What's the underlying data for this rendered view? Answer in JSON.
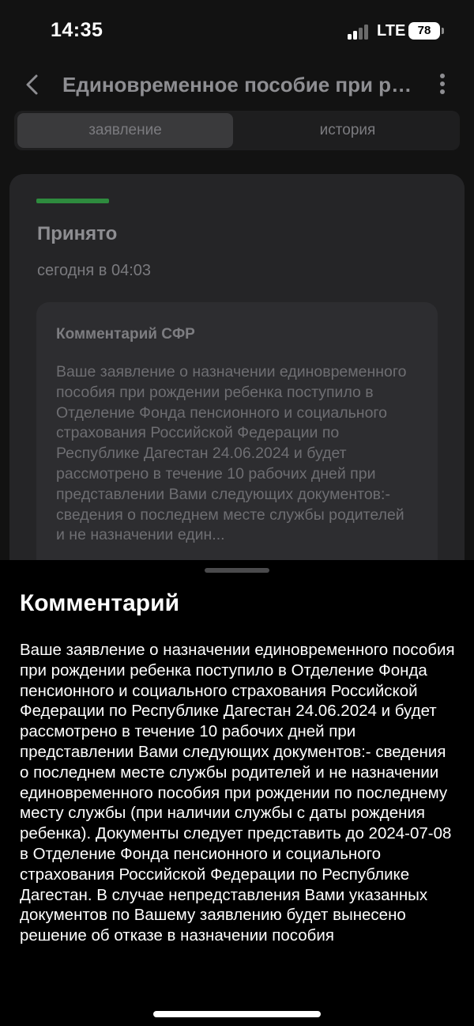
{
  "status_bar": {
    "time": "14:35",
    "network": "LTE",
    "battery": "78"
  },
  "nav": {
    "title": "Единовременное пособие при рождении ребенка"
  },
  "tabs": [
    {
      "label": "заявление",
      "active": true
    },
    {
      "label": "история",
      "active": false
    }
  ],
  "card": {
    "status_color": "#2e8b3e",
    "status_title": "Принято",
    "status_date": "сегодня в 04:03",
    "comment_title": "Комментарий СФР",
    "comment_preview": "Ваше заявление о назначении единовременного пособия при рождении ребенка поступило в Отделение Фонда пенсионного и социального страхования Российской Федерации по Республике Дагестан 24.06.2024 и будет рассмотрено в течение 10 рабочих дней при представлении Вами следующих документов:- сведения о последнем месте службы родителей и не назначении един..."
  },
  "sheet": {
    "title": "Комментарий",
    "text": "Ваше заявление о назначении единовременного пособия при рождении ребенка поступило в Отделение Фонда пенсионного и социального страхования Российской Федерации по Республике Дагестан 24.06.2024 и будет рассмотрено в течение 10 рабочих дней при представлении Вами следующих документов:- сведения о последнем месте службы родителей и не назначении единовременного пособия при рождении по последнему месту службы (при наличии службы с даты рождения ребенка). Документы следует представить до 2024-07-08 в Отделение Фонда пенсионного и социального страхования Российской Федерации по Республике Дагестан. В случае непредставления Вами указанных документов по Вашему заявлению будет вынесено решение об отказе в назначении пособия"
  },
  "colors": {
    "background": "#121212",
    "sheet_background": "#000000",
    "accent_green": "#2e8b3e"
  }
}
